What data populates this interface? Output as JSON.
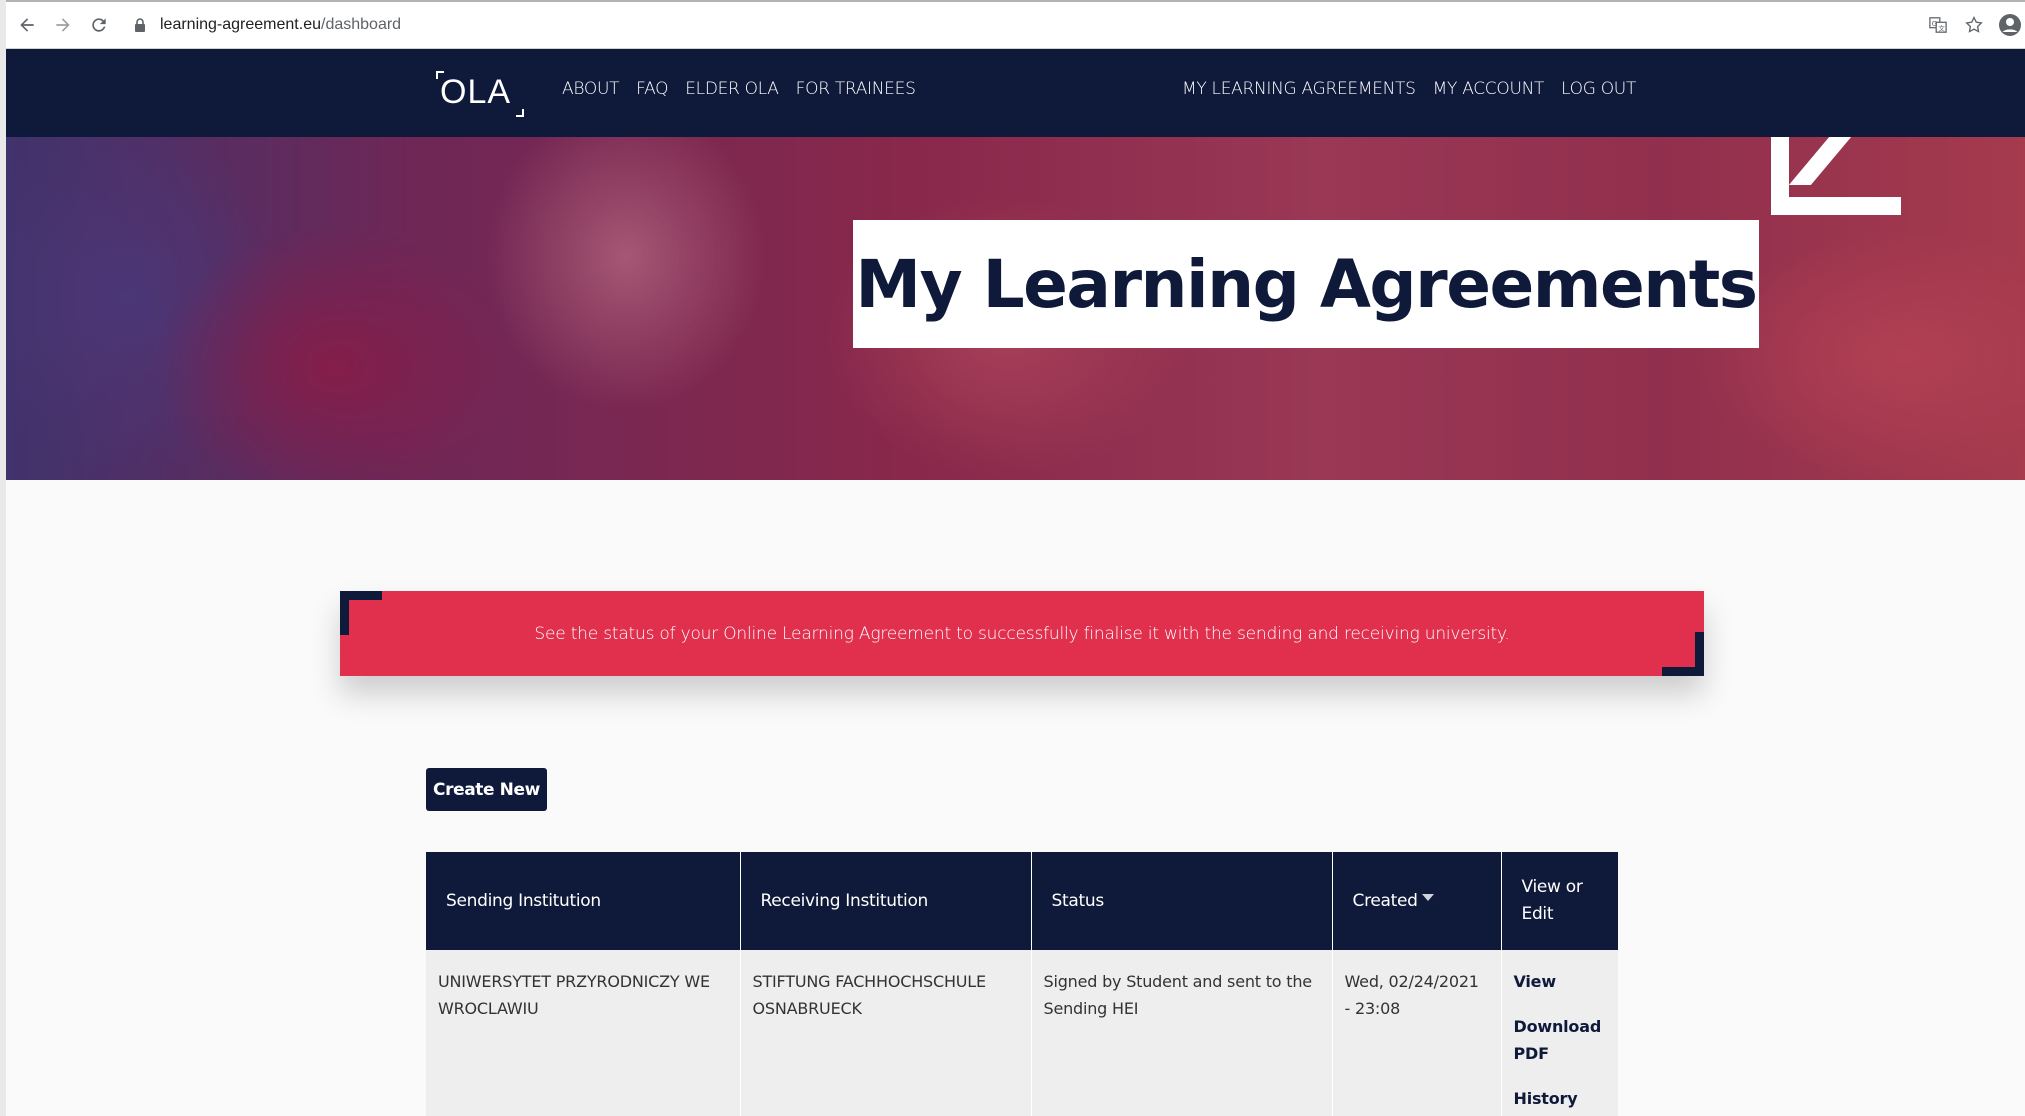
{
  "browser": {
    "url_host": "learning-agreement.eu",
    "url_path": "/dashboard"
  },
  "header": {
    "logo_text": "OLA",
    "nav_left": [
      "ABOUT",
      "FAQ",
      "ELDER OLA",
      "FOR TRAINEES"
    ],
    "nav_right": [
      "MY LEARNING AGREEMENTS",
      "MY ACCOUNT",
      "LOG OUT"
    ]
  },
  "hero": {
    "title": "My Learning Agreements"
  },
  "banner": {
    "text": "See the status of your Online Learning Agreement to successfully finalise it with the sending and receiving university."
  },
  "actions": {
    "create_new": "Create New"
  },
  "table": {
    "headers": {
      "sending": "Sending Institution",
      "receiving": "Receiving Institution",
      "status": "Status",
      "created": "Created",
      "view_edit": "View or Edit"
    },
    "rows": [
      {
        "sending": "UNIWERSYTET PRZYRODNICZY WE WROCLAWIU",
        "receiving": "STIFTUNG FACHHOCHSCHULE OSNABRUECK",
        "status": "Signed by Student and sent to the Sending HEI",
        "created": "Wed, 02/24/2021 - 23:08",
        "links": {
          "view": "View",
          "download": "Download PDF",
          "history": "History"
        }
      }
    ]
  },
  "colors": {
    "navy": "#0f1a3a",
    "banner_red": "#e0304e"
  }
}
